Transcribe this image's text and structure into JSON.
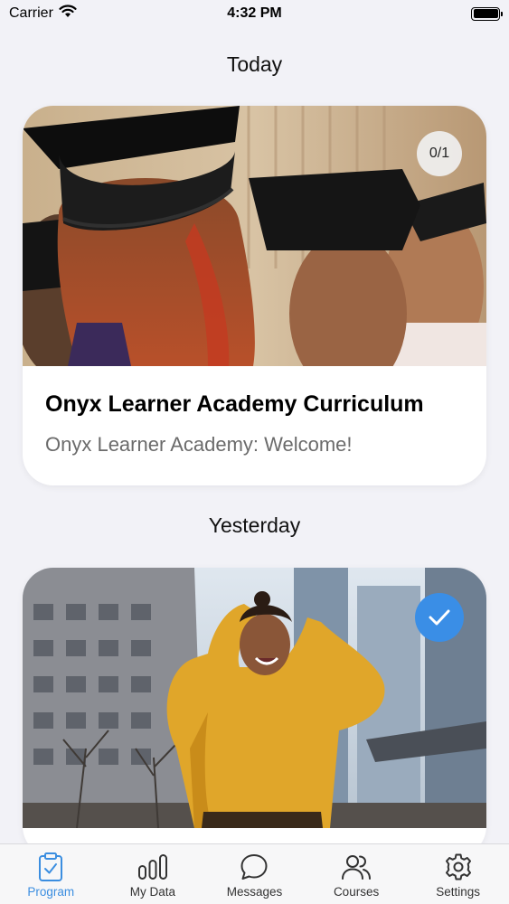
{
  "status_bar": {
    "carrier": "Carrier",
    "time": "4:32 PM"
  },
  "sections": [
    {
      "header": "Today"
    },
    {
      "header": "Yesterday"
    }
  ],
  "cards": [
    {
      "title": "Onyx Learner Academy Curriculum",
      "subtitle": "Onyx Learner Academy: Welcome!",
      "progress": "0/1",
      "completed": false
    },
    {
      "completed": true
    }
  ],
  "tabs": [
    {
      "label": "Program",
      "icon": "clipboard-check-icon",
      "active": true
    },
    {
      "label": "My Data",
      "icon": "bar-chart-icon",
      "active": false
    },
    {
      "label": "Messages",
      "icon": "chat-bubble-icon",
      "active": false
    },
    {
      "label": "Courses",
      "icon": "people-icon",
      "active": false
    },
    {
      "label": "Settings",
      "icon": "gear-icon",
      "active": false
    }
  ],
  "colors": {
    "accent": "#3b8ee0",
    "check_badge": "#3a8ee6",
    "background": "#f2f2f7"
  }
}
